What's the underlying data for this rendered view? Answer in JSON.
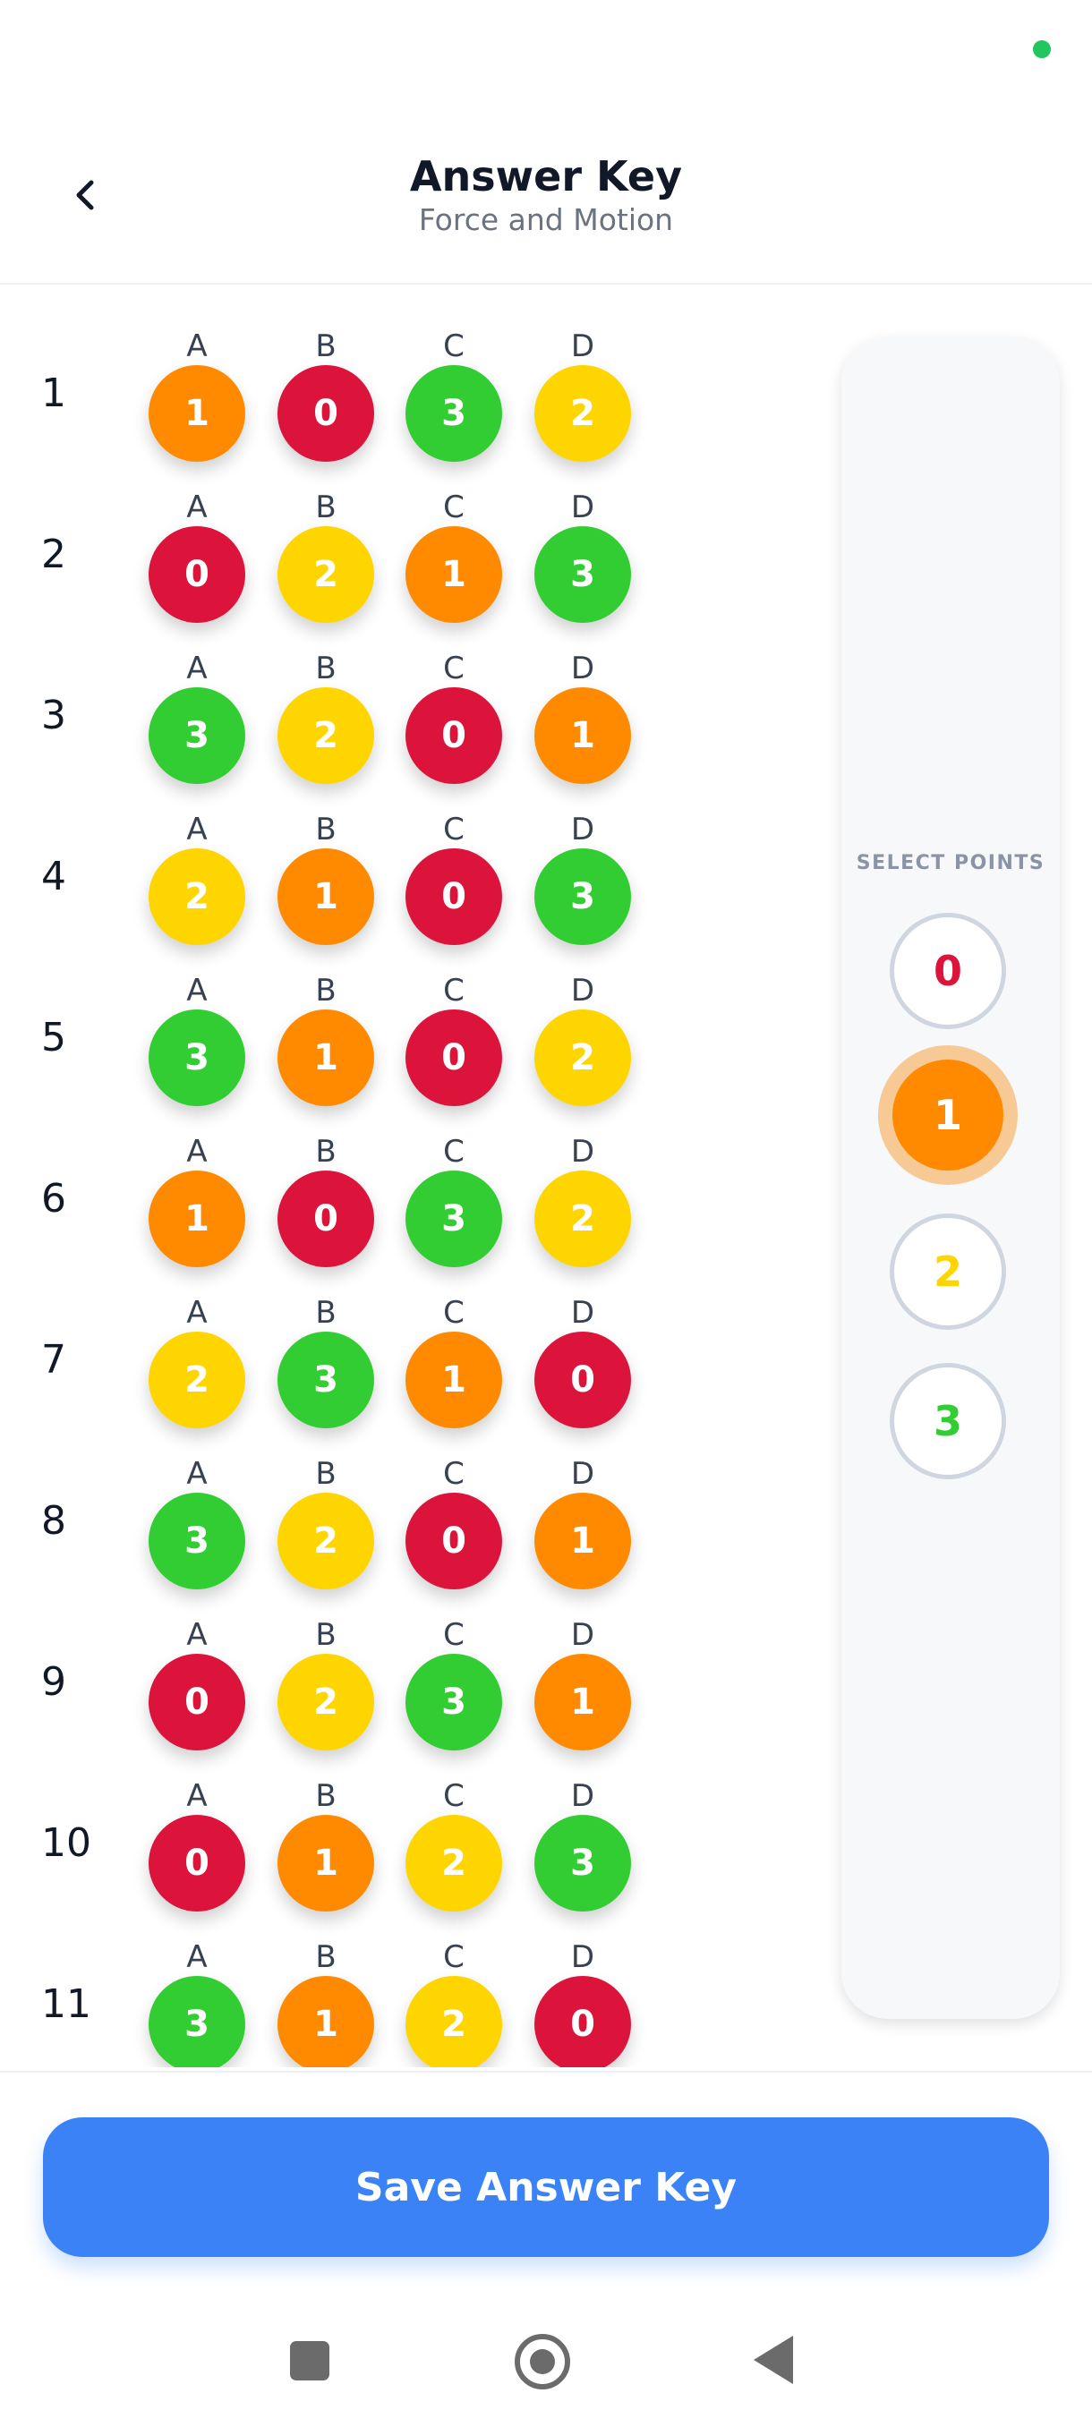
{
  "header": {
    "title": "Answer Key",
    "subtitle": "Force and Motion"
  },
  "colors": {
    "0": "#dc143c",
    "1": "#ff8a00",
    "2": "#ffd500",
    "3": "#32cd32"
  },
  "questions": [
    {
      "num": "1",
      "options": [
        {
          "letter": "A",
          "value": "1"
        },
        {
          "letter": "B",
          "value": "0"
        },
        {
          "letter": "C",
          "value": "3"
        },
        {
          "letter": "D",
          "value": "2"
        }
      ]
    },
    {
      "num": "2",
      "options": [
        {
          "letter": "A",
          "value": "0"
        },
        {
          "letter": "B",
          "value": "2"
        },
        {
          "letter": "C",
          "value": "1"
        },
        {
          "letter": "D",
          "value": "3"
        }
      ]
    },
    {
      "num": "3",
      "options": [
        {
          "letter": "A",
          "value": "3"
        },
        {
          "letter": "B",
          "value": "2"
        },
        {
          "letter": "C",
          "value": "0"
        },
        {
          "letter": "D",
          "value": "1"
        }
      ]
    },
    {
      "num": "4",
      "options": [
        {
          "letter": "A",
          "value": "2"
        },
        {
          "letter": "B",
          "value": "1"
        },
        {
          "letter": "C",
          "value": "0"
        },
        {
          "letter": "D",
          "value": "3"
        }
      ]
    },
    {
      "num": "5",
      "options": [
        {
          "letter": "A",
          "value": "3"
        },
        {
          "letter": "B",
          "value": "1"
        },
        {
          "letter": "C",
          "value": "0"
        },
        {
          "letter": "D",
          "value": "2"
        }
      ]
    },
    {
      "num": "6",
      "options": [
        {
          "letter": "A",
          "value": "1"
        },
        {
          "letter": "B",
          "value": "0"
        },
        {
          "letter": "C",
          "value": "3"
        },
        {
          "letter": "D",
          "value": "2"
        }
      ]
    },
    {
      "num": "7",
      "options": [
        {
          "letter": "A",
          "value": "2"
        },
        {
          "letter": "B",
          "value": "3"
        },
        {
          "letter": "C",
          "value": "1"
        },
        {
          "letter": "D",
          "value": "0"
        }
      ]
    },
    {
      "num": "8",
      "options": [
        {
          "letter": "A",
          "value": "3"
        },
        {
          "letter": "B",
          "value": "2"
        },
        {
          "letter": "C",
          "value": "0"
        },
        {
          "letter": "D",
          "value": "1"
        }
      ]
    },
    {
      "num": "9",
      "options": [
        {
          "letter": "A",
          "value": "0"
        },
        {
          "letter": "B",
          "value": "2"
        },
        {
          "letter": "C",
          "value": "3"
        },
        {
          "letter": "D",
          "value": "1"
        }
      ]
    },
    {
      "num": "10",
      "options": [
        {
          "letter": "A",
          "value": "0"
        },
        {
          "letter": "B",
          "value": "1"
        },
        {
          "letter": "C",
          "value": "2"
        },
        {
          "letter": "D",
          "value": "3"
        }
      ]
    },
    {
      "num": "11",
      "options": [
        {
          "letter": "A",
          "value": "3"
        },
        {
          "letter": "B",
          "value": "1"
        },
        {
          "letter": "C",
          "value": "2"
        },
        {
          "letter": "D",
          "value": "0"
        }
      ]
    }
  ],
  "points_panel": {
    "label": "SELECT POINTS",
    "selected": "1",
    "options": [
      "0",
      "1",
      "2",
      "3"
    ]
  },
  "footer": {
    "save_label": "Save Answer Key"
  },
  "navbar": {
    "icons": [
      "recents-square-icon",
      "home-circle-icon",
      "back-triangle-icon"
    ]
  }
}
